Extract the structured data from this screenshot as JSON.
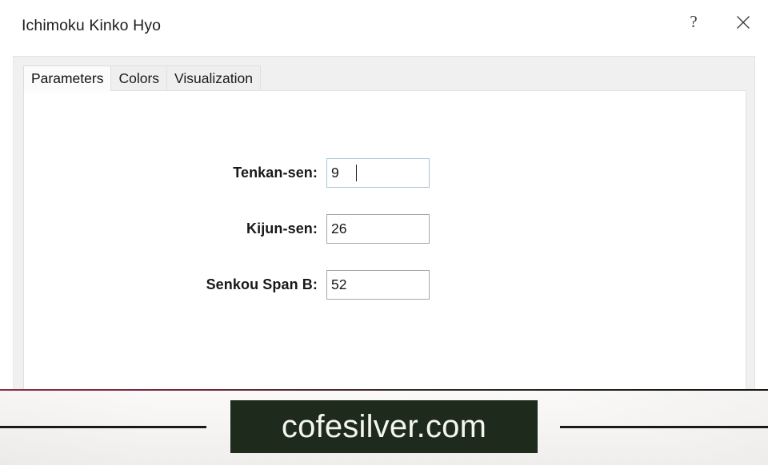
{
  "window": {
    "title": "Ichimoku Kinko Hyo",
    "help_label": "?",
    "close_label": "✕"
  },
  "tabs": [
    {
      "label": "Parameters",
      "selected": true
    },
    {
      "label": "Colors",
      "selected": false
    },
    {
      "label": "Visualization",
      "selected": false
    }
  ],
  "parameters": {
    "fields": [
      {
        "label": "Tenkan-sen:",
        "value": "9",
        "focused": true
      },
      {
        "label": "Kijun-sen:",
        "value": "26",
        "focused": false
      },
      {
        "label": "Senkou Span B:",
        "value": "52",
        "focused": false
      }
    ]
  },
  "footer": {
    "watermark": "cofesilver.com"
  },
  "colors": {
    "dialog_background": "#ffffff",
    "tab_strip_background": "#f0f0f0",
    "tab_selected_background": "#fbfbfb",
    "input_border": "#a6a6a6",
    "input_border_focused": "#aac8d8",
    "title_text": "#1d1d1d",
    "watermark_box": "#1e2a1c",
    "watermark_text": "#f4f5f0",
    "footer_top_line": "#8e2b4a",
    "footer_rule": "#1a1a1a"
  }
}
